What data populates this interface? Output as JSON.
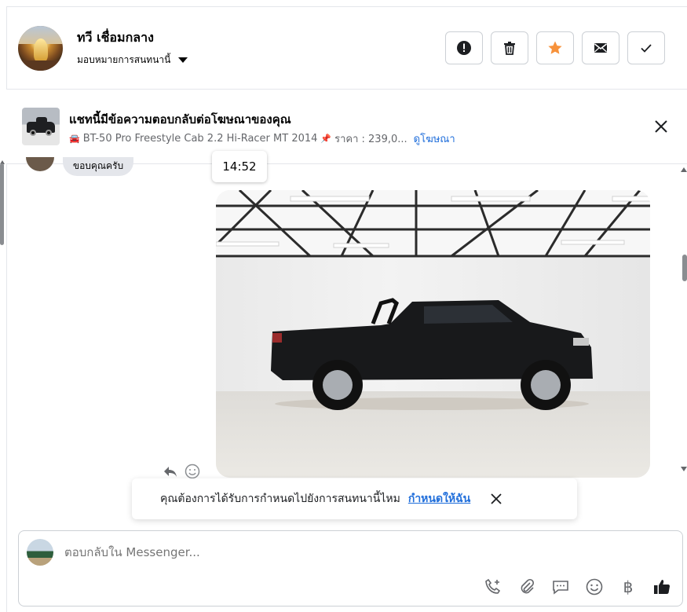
{
  "header": {
    "contact_name": "ทวี เชื่อมกลาง",
    "assign_label": "มอบหมายการสนทนานี้",
    "buttons": {
      "spam": "spam-icon",
      "delete": "trash-icon",
      "star": "star-icon",
      "unread": "envelope-icon",
      "done": "check-icon"
    },
    "colors": {
      "star": "#f7923b"
    }
  },
  "ad_banner": {
    "title": "แชทนี้มีข้อความตอบกลับต่อโฆษณาของคุณ",
    "car_emoji": "🚘",
    "listing": "BT-50 Pro Freestyle Cab 2.2 Hi-Racer MT 2014",
    "pin_emoji": "📌",
    "price": "ราคา : 239,0...",
    "view_ad": "ดูโฆษณา"
  },
  "conversation": {
    "timestamp": "14:52",
    "previous_text": "ขอบคุณครับ"
  },
  "assign_toast": {
    "prompt": "คุณต้องการได้รับการกำหนดไปยังการสนทนานี้ไหม",
    "action": "กำหนดให้ฉัน"
  },
  "composer": {
    "placeholder": "ตอบกลับใน Messenger...",
    "currency_symbol": "฿"
  }
}
